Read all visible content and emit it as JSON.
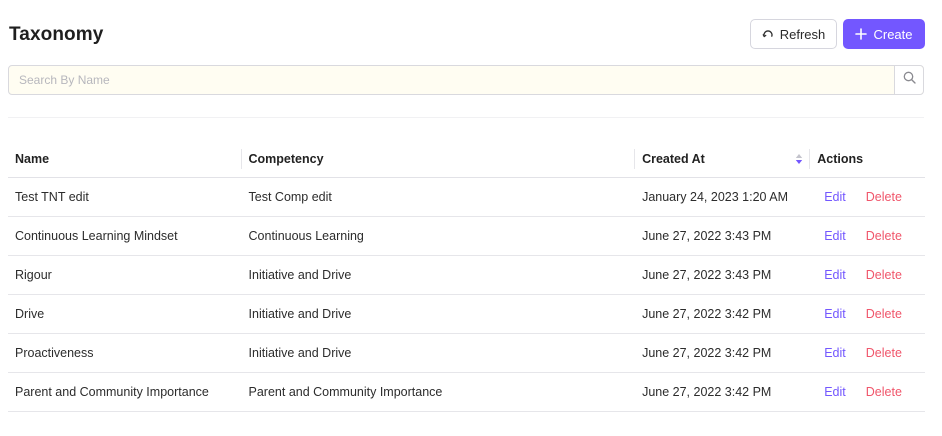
{
  "header": {
    "title": "Taxonomy",
    "refresh_label": "Refresh",
    "create_label": "Create"
  },
  "search": {
    "placeholder": "Search By Name",
    "value": ""
  },
  "table": {
    "columns": [
      "Name",
      "Competency",
      "Created At",
      "Actions"
    ],
    "sorted_column": "Created At",
    "rows": [
      {
        "name": "Test TNT edit",
        "competency": "Test Comp edit",
        "created_at": "January 24, 2023 1:20 AM",
        "edit": "Edit",
        "delete": "Delete"
      },
      {
        "name": "Continuous Learning Mindset",
        "competency": "Continuous Learning",
        "created_at": "June 27, 2022 3:43 PM",
        "edit": "Edit",
        "delete": "Delete"
      },
      {
        "name": "Rigour",
        "competency": "Initiative and Drive",
        "created_at": "June 27, 2022 3:43 PM",
        "edit": "Edit",
        "delete": "Delete"
      },
      {
        "name": "Drive",
        "competency": "Initiative and Drive",
        "created_at": "June 27, 2022 3:42 PM",
        "edit": "Edit",
        "delete": "Delete"
      },
      {
        "name": "Proactiveness",
        "competency": "Initiative and Drive",
        "created_at": "June 27, 2022 3:42 PM",
        "edit": "Edit",
        "delete": "Delete"
      },
      {
        "name": "Parent and Community Importance",
        "competency": "Parent and Community Importance",
        "created_at": "June 27, 2022 3:42 PM",
        "edit": "Edit",
        "delete": "Delete"
      }
    ]
  },
  "icons": {
    "refresh": "refresh-icon",
    "create": "plus-icon",
    "search": "search-icon",
    "sort": "sort-icon"
  },
  "colors": {
    "accent": "#7357ff",
    "delete": "#f0566b",
    "search_background": "#fffdf2"
  }
}
